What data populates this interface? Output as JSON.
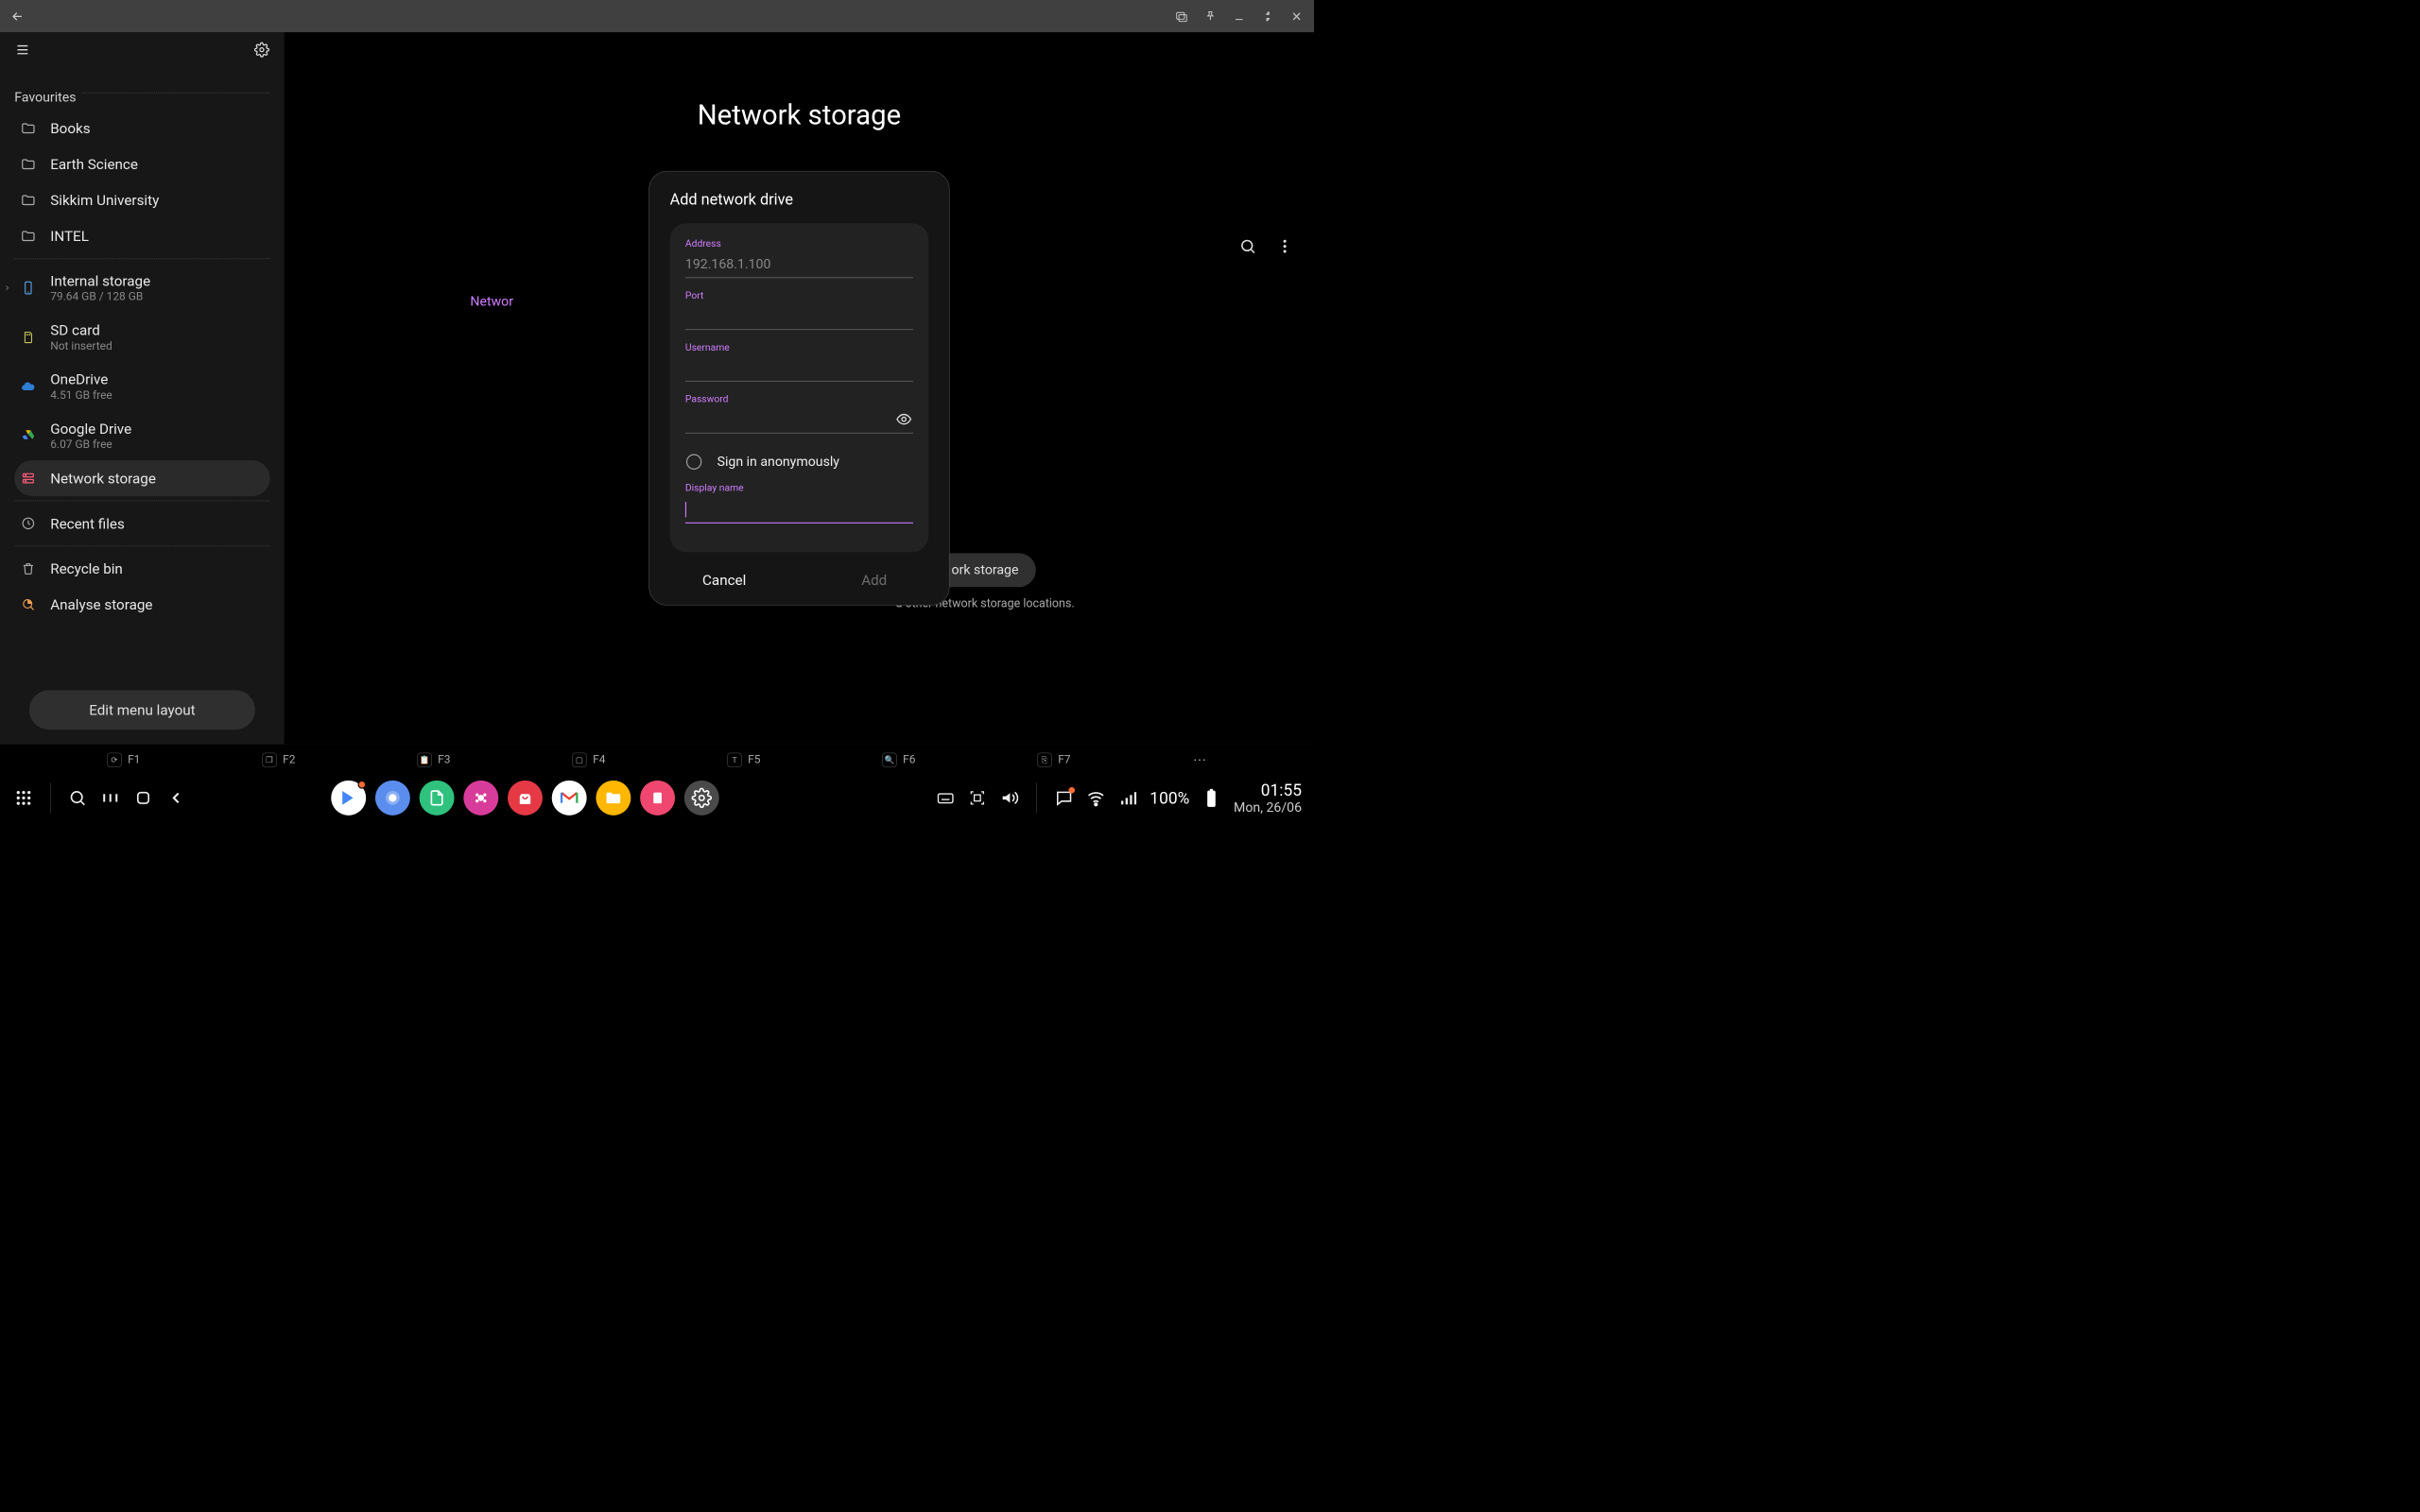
{
  "titlebar": {
    "back": "back"
  },
  "sidebar": {
    "section_favourites": "Favourites",
    "favourites": [
      {
        "label": "Books"
      },
      {
        "label": "Earth Science"
      },
      {
        "label": "Sikkim University"
      },
      {
        "label": "INTEL"
      }
    ],
    "storage": [
      {
        "label": "Internal storage",
        "sub": "79.64 GB / 128 GB",
        "icon": "phone"
      },
      {
        "label": "SD card",
        "sub": "Not inserted",
        "icon": "sdcard"
      },
      {
        "label": "OneDrive",
        "sub": "4.51 GB free",
        "icon": "onedrive"
      },
      {
        "label": "Google Drive",
        "sub": "6.07 GB free",
        "icon": "gdrive"
      },
      {
        "label": "Network storage",
        "sub": "",
        "icon": "network",
        "active": true
      }
    ],
    "utilities": [
      {
        "label": "Recent files",
        "icon": "clock"
      },
      {
        "label": "Recycle bin",
        "icon": "trash"
      },
      {
        "label": "Analyse storage",
        "icon": "analyse"
      }
    ],
    "edit_menu": "Edit menu layout"
  },
  "main": {
    "title": "Network storage",
    "breadcrumb_partial": "Networ",
    "add_btn_partial": "ork storage",
    "add_caption_partial": "d other network storage locations."
  },
  "dialog": {
    "title": "Add network drive",
    "address_label": "Address",
    "address_placeholder": "192.168.1.100",
    "address_value": "",
    "port_label": "Port",
    "port_value": "",
    "username_label": "Username",
    "username_value": "",
    "password_label": "Password",
    "password_value": "",
    "anon_label": "Sign in anonymously",
    "display_name_label": "Display name",
    "display_name_value": "",
    "cancel": "Cancel",
    "add": "Add"
  },
  "fkeys": {
    "f1": "F1",
    "f2": "F2",
    "f3": "F3",
    "f4": "F4",
    "f5": "F5",
    "f6": "F6",
    "f7": "F7"
  },
  "statusbar": {
    "battery_pct": "100%",
    "time": "01:55",
    "date": "Mon, 26/06"
  }
}
